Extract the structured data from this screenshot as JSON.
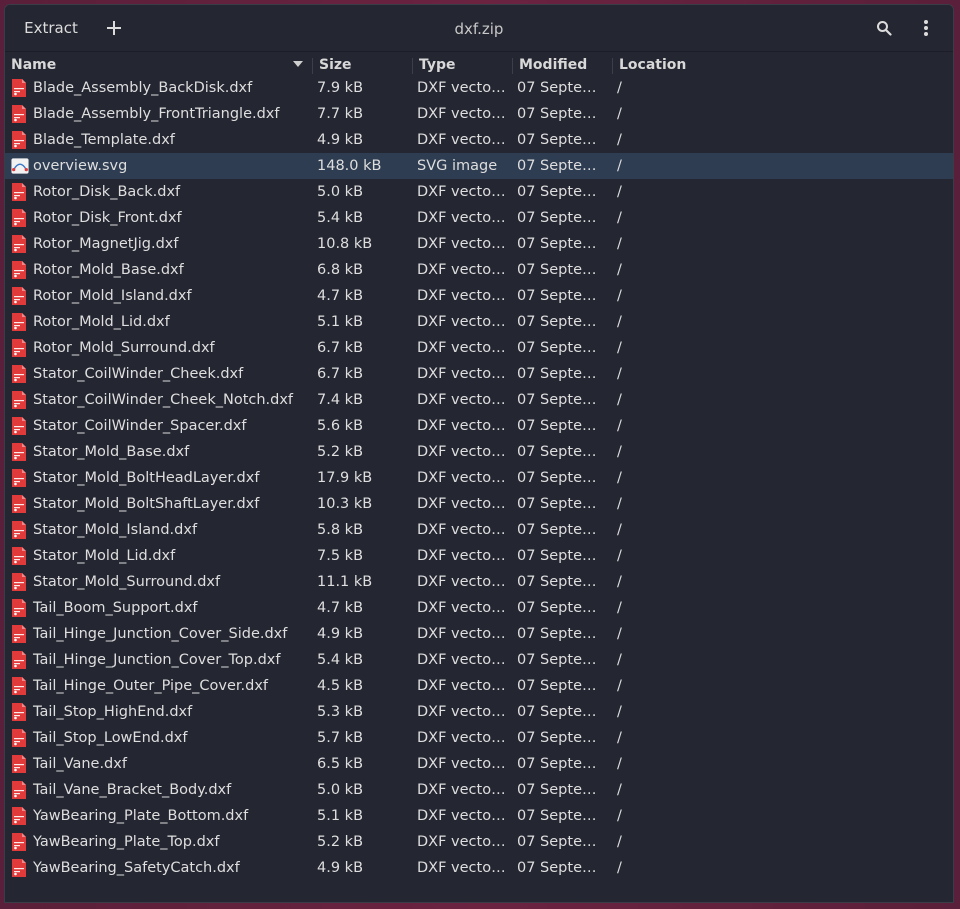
{
  "window": {
    "title": "dxf.zip"
  },
  "toolbar": {
    "extract_label": "Extract",
    "add_icon": "plus-icon",
    "search_icon": "search-icon",
    "menu_icon": "vertical-dots-icon"
  },
  "columns": {
    "name": "Name",
    "size": "Size",
    "type": "Type",
    "modified": "Modified",
    "location": "Location",
    "sort": "descending-on-name"
  },
  "colors": {
    "dxf_icon": "#e03a3a",
    "svg_icon": "#4a90d9",
    "selected_row": "#2f3d52"
  },
  "files": [
    {
      "name": "Blade_Assembly_BackDisk.dxf",
      "size": "7.9  kB",
      "type": "DXF vecto…",
      "modified": "07 Septe…",
      "location": "/",
      "icon": "dxf-file-icon"
    },
    {
      "name": "Blade_Assembly_FrontTriangle.dxf",
      "size": "7.7  kB",
      "type": "DXF vecto…",
      "modified": "07 Septe…",
      "location": "/",
      "icon": "dxf-file-icon"
    },
    {
      "name": "Blade_Template.dxf",
      "size": "4.9  kB",
      "type": "DXF vecto…",
      "modified": "07 Septe…",
      "location": "/",
      "icon": "dxf-file-icon"
    },
    {
      "name": "overview.svg",
      "size": "148.0  kB",
      "type": "SVG image",
      "modified": "07 Septe…",
      "location": "/",
      "icon": "svg-file-icon",
      "selected": true
    },
    {
      "name": "Rotor_Disk_Back.dxf",
      "size": "5.0  kB",
      "type": "DXF vecto…",
      "modified": "07 Septe…",
      "location": "/",
      "icon": "dxf-file-icon"
    },
    {
      "name": "Rotor_Disk_Front.dxf",
      "size": "5.4  kB",
      "type": "DXF vecto…",
      "modified": "07 Septe…",
      "location": "/",
      "icon": "dxf-file-icon"
    },
    {
      "name": "Rotor_MagnetJig.dxf",
      "size": "10.8  kB",
      "type": "DXF vecto…",
      "modified": "07 Septe…",
      "location": "/",
      "icon": "dxf-file-icon"
    },
    {
      "name": "Rotor_Mold_Base.dxf",
      "size": "6.8  kB",
      "type": "DXF vecto…",
      "modified": "07 Septe…",
      "location": "/",
      "icon": "dxf-file-icon"
    },
    {
      "name": "Rotor_Mold_Island.dxf",
      "size": "4.7  kB",
      "type": "DXF vecto…",
      "modified": "07 Septe…",
      "location": "/",
      "icon": "dxf-file-icon"
    },
    {
      "name": "Rotor_Mold_Lid.dxf",
      "size": "5.1  kB",
      "type": "DXF vecto…",
      "modified": "07 Septe…",
      "location": "/",
      "icon": "dxf-file-icon"
    },
    {
      "name": "Rotor_Mold_Surround.dxf",
      "size": "6.7  kB",
      "type": "DXF vecto…",
      "modified": "07 Septe…",
      "location": "/",
      "icon": "dxf-file-icon"
    },
    {
      "name": "Stator_CoilWinder_Cheek.dxf",
      "size": "6.7  kB",
      "type": "DXF vecto…",
      "modified": "07 Septe…",
      "location": "/",
      "icon": "dxf-file-icon"
    },
    {
      "name": "Stator_CoilWinder_Cheek_Notch.dxf",
      "size": "7.4  kB",
      "type": "DXF vecto…",
      "modified": "07 Septe…",
      "location": "/",
      "icon": "dxf-file-icon"
    },
    {
      "name": "Stator_CoilWinder_Spacer.dxf",
      "size": "5.6  kB",
      "type": "DXF vecto…",
      "modified": "07 Septe…",
      "location": "/",
      "icon": "dxf-file-icon"
    },
    {
      "name": "Stator_Mold_Base.dxf",
      "size": "5.2  kB",
      "type": "DXF vecto…",
      "modified": "07 Septe…",
      "location": "/",
      "icon": "dxf-file-icon"
    },
    {
      "name": "Stator_Mold_BoltHeadLayer.dxf",
      "size": "17.9  kB",
      "type": "DXF vecto…",
      "modified": "07 Septe…",
      "location": "/",
      "icon": "dxf-file-icon"
    },
    {
      "name": "Stator_Mold_BoltShaftLayer.dxf",
      "size": "10.3  kB",
      "type": "DXF vecto…",
      "modified": "07 Septe…",
      "location": "/",
      "icon": "dxf-file-icon"
    },
    {
      "name": "Stator_Mold_Island.dxf",
      "size": "5.8  kB",
      "type": "DXF vecto…",
      "modified": "07 Septe…",
      "location": "/",
      "icon": "dxf-file-icon"
    },
    {
      "name": "Stator_Mold_Lid.dxf",
      "size": "7.5  kB",
      "type": "DXF vecto…",
      "modified": "07 Septe…",
      "location": "/",
      "icon": "dxf-file-icon"
    },
    {
      "name": "Stator_Mold_Surround.dxf",
      "size": "11.1  kB",
      "type": "DXF vecto…",
      "modified": "07 Septe…",
      "location": "/",
      "icon": "dxf-file-icon"
    },
    {
      "name": "Tail_Boom_Support.dxf",
      "size": "4.7  kB",
      "type": "DXF vecto…",
      "modified": "07 Septe…",
      "location": "/",
      "icon": "dxf-file-icon"
    },
    {
      "name": "Tail_Hinge_Junction_Cover_Side.dxf",
      "size": "4.9  kB",
      "type": "DXF vecto…",
      "modified": "07 Septe…",
      "location": "/",
      "icon": "dxf-file-icon"
    },
    {
      "name": "Tail_Hinge_Junction_Cover_Top.dxf",
      "size": "5.4  kB",
      "type": "DXF vecto…",
      "modified": "07 Septe…",
      "location": "/",
      "icon": "dxf-file-icon"
    },
    {
      "name": "Tail_Hinge_Outer_Pipe_Cover.dxf",
      "size": "4.5  kB",
      "type": "DXF vecto…",
      "modified": "07 Septe…",
      "location": "/",
      "icon": "dxf-file-icon"
    },
    {
      "name": "Tail_Stop_HighEnd.dxf",
      "size": "5.3  kB",
      "type": "DXF vecto…",
      "modified": "07 Septe…",
      "location": "/",
      "icon": "dxf-file-icon"
    },
    {
      "name": "Tail_Stop_LowEnd.dxf",
      "size": "5.7  kB",
      "type": "DXF vecto…",
      "modified": "07 Septe…",
      "location": "/",
      "icon": "dxf-file-icon"
    },
    {
      "name": "Tail_Vane.dxf",
      "size": "6.5  kB",
      "type": "DXF vecto…",
      "modified": "07 Septe…",
      "location": "/",
      "icon": "dxf-file-icon"
    },
    {
      "name": "Tail_Vane_Bracket_Body.dxf",
      "size": "5.0  kB",
      "type": "DXF vecto…",
      "modified": "07 Septe…",
      "location": "/",
      "icon": "dxf-file-icon"
    },
    {
      "name": "YawBearing_Plate_Bottom.dxf",
      "size": "5.1  kB",
      "type": "DXF vecto…",
      "modified": "07 Septe…",
      "location": "/",
      "icon": "dxf-file-icon"
    },
    {
      "name": "YawBearing_Plate_Top.dxf",
      "size": "5.2  kB",
      "type": "DXF vecto…",
      "modified": "07 Septe…",
      "location": "/",
      "icon": "dxf-file-icon"
    },
    {
      "name": "YawBearing_SafetyCatch.dxf",
      "size": "4.9  kB",
      "type": "DXF vecto…",
      "modified": "07 Septe…",
      "location": "/",
      "icon": "dxf-file-icon"
    }
  ]
}
